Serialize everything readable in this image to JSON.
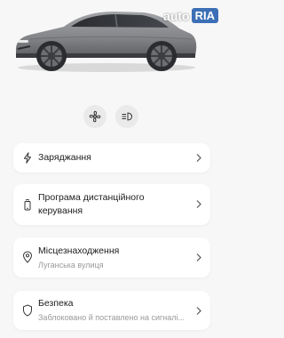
{
  "watermark": {
    "auto": "auto",
    "ria": "RIA"
  },
  "quick_actions": [
    {
      "icon": "fan-icon"
    },
    {
      "icon": "headlights-icon"
    }
  ],
  "menu": [
    {
      "title": "Заряджання",
      "subtitle": "",
      "icon": "lightning-bolt-icon"
    },
    {
      "title": "Програма дистанційного керування",
      "subtitle": "",
      "icon": "phone-remote-icon"
    },
    {
      "title": "Місцезнаходження",
      "subtitle": "Луганська вулиця",
      "icon": "location-pin-icon"
    },
    {
      "title": "Безпека",
      "subtitle": "Заблоковано й поставлено на сигналі...",
      "icon": "shield-icon"
    }
  ],
  "colors": {
    "background": "#f7f7f7",
    "card": "#ffffff",
    "car_body": "#8a8b8f",
    "subtitle": "#9a9a9a",
    "ria_badge": "#3c6fb5"
  }
}
